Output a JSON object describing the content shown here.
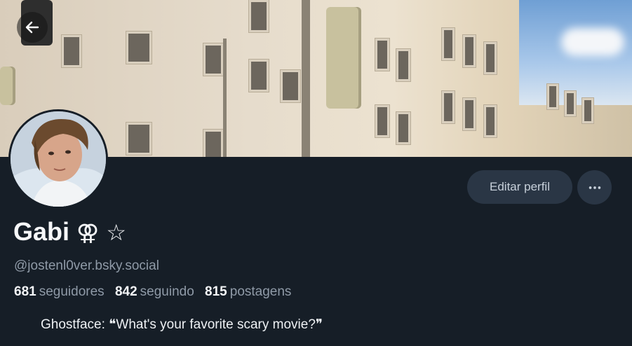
{
  "profile": {
    "name": "Gabi",
    "name_symbols": "⚢ ☆",
    "handle": "@jostenl0ver.bsky.social",
    "bio": "Ghostface: ❝What's your favorite scary movie?❞"
  },
  "stats": {
    "followers_count": "681",
    "followers_label": "seguidores",
    "following_count": "842",
    "following_label": "seguindo",
    "posts_count": "815",
    "posts_label": "postagens"
  },
  "actions": {
    "edit_label": "Editar perfil"
  },
  "icons": {
    "back": "arrow-left-icon",
    "more": "ellipsis-icon"
  },
  "colors": {
    "background": "#161e27",
    "button": "#2a3645",
    "muted_text": "#8f9aa7"
  }
}
